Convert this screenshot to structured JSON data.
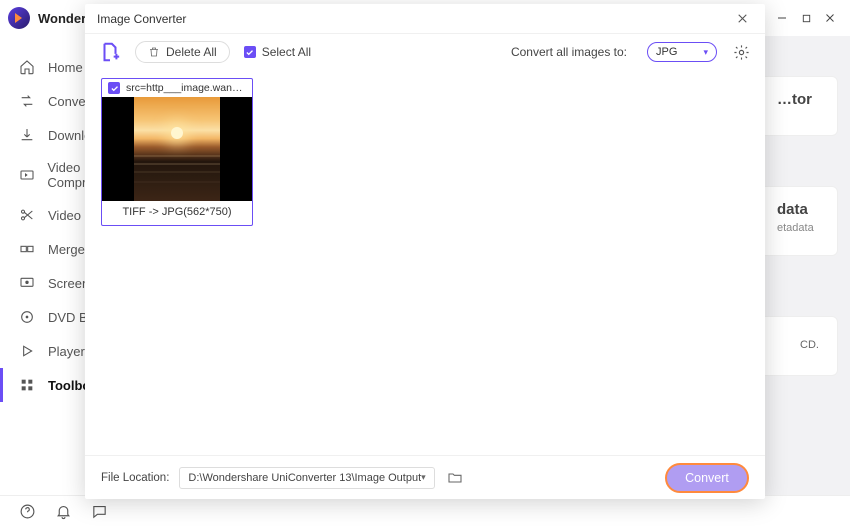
{
  "app": {
    "title": "Wondershare UniConverter"
  },
  "window_controls": {
    "min": "minimize",
    "max": "maximize",
    "close": "close"
  },
  "sidebar": {
    "items": [
      {
        "label": "Home"
      },
      {
        "label": "Converter"
      },
      {
        "label": "Downloader"
      },
      {
        "label": "Video Compressor"
      },
      {
        "label": "Video Editor"
      },
      {
        "label": "Merger"
      },
      {
        "label": "Screen Recorder"
      },
      {
        "label": "DVD Burner"
      },
      {
        "label": "Player"
      },
      {
        "label": "Toolbox"
      }
    ]
  },
  "modal": {
    "title": "Image Converter",
    "delete_all": "Delete All",
    "select_all": "Select All",
    "convert_all_label": "Convert all images to:",
    "format": "JPG",
    "file": {
      "name": "src=http___image.wangc...",
      "info": "TIFF -> JPG(562*750)"
    },
    "footer": {
      "file_location_label": "File Location:",
      "path": "D:\\Wondershare UniConverter 13\\Image Output",
      "convert": "Convert"
    }
  },
  "bg": {
    "card1_title": "…tor",
    "card2_title": "data",
    "card2_sub": "etadata",
    "card3_text": "CD."
  }
}
